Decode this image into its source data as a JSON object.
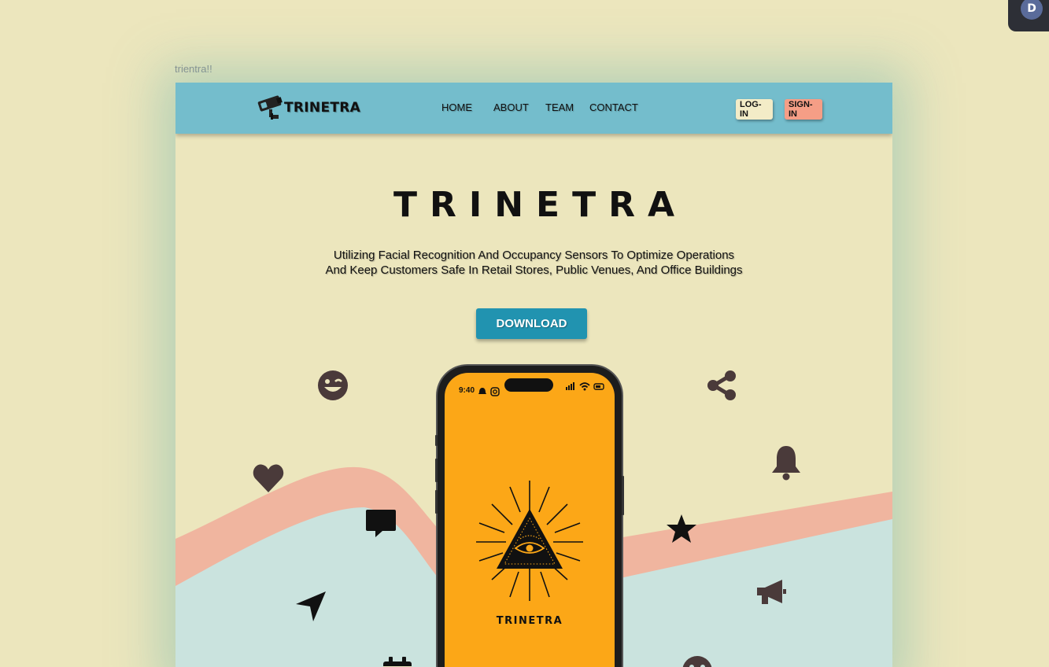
{
  "page": {
    "caption": "trientra!!"
  },
  "user": {
    "avatar_initial": "D"
  },
  "nav": {
    "brand": "TRINETRA",
    "links": [
      "HOME",
      "ABOUT",
      "TEAM",
      "CONTACT"
    ],
    "login_label": "LOG-IN",
    "signin_label": "SIGN-IN"
  },
  "hero": {
    "title": "TRINETRA",
    "subtitle_line1": "Utilizing Facial Recognition And Occupancy Sensors To Optimize Operations",
    "subtitle_line2": "And Keep Customers Safe In Retail Stores, Public Venues, And Office Buildings",
    "download_label": "DOWNLOAD"
  },
  "phone": {
    "time": "9:40",
    "app_name": "TRINETRA"
  },
  "icons": [
    "wink-icon",
    "share-icon",
    "heart-icon",
    "bell-icon",
    "chat-icon",
    "star-icon",
    "navigation-icon",
    "megaphone-icon",
    "calendar-icon",
    "smiley-icon"
  ],
  "colors": {
    "background": "#ece6bd",
    "navbar": "#74bdcc",
    "login_button": "#f3ecc7",
    "signin_button": "#f59e86",
    "download_button": "#2193b0",
    "wave_salmon": "#f0b59f",
    "wave_mint": "#cae3de",
    "phone_screen": "#fca717"
  }
}
